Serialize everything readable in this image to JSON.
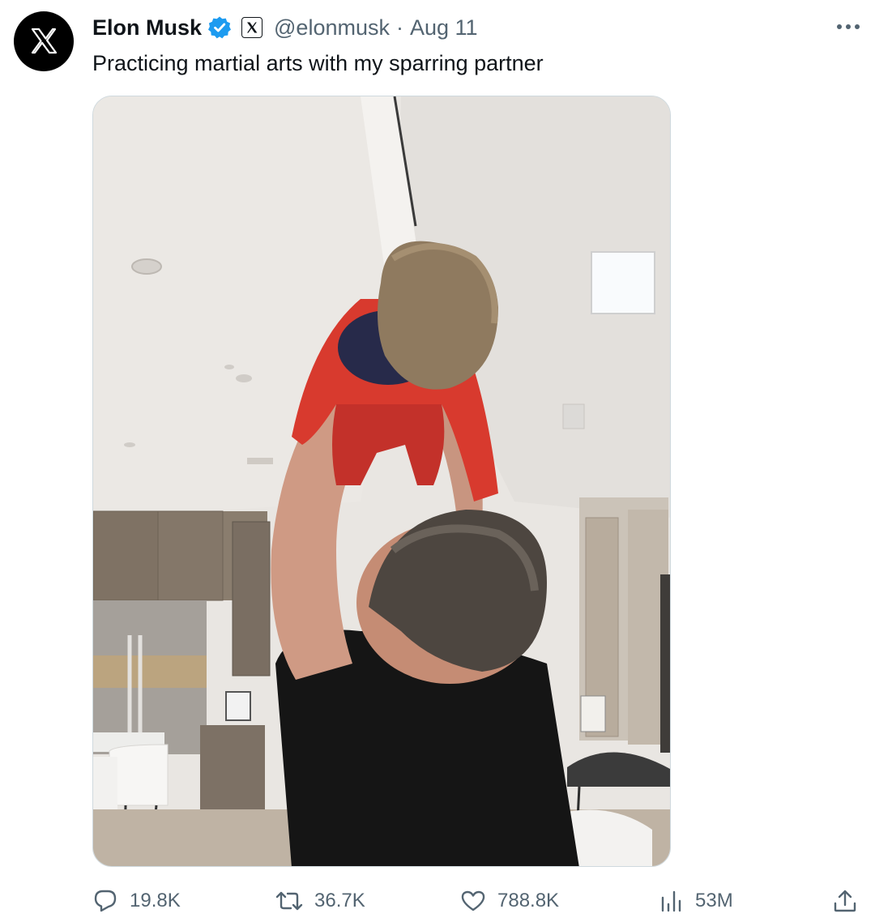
{
  "author": {
    "name": "Elon Musk",
    "handle": "@elonmusk",
    "separator": "·",
    "date": "Aug 11"
  },
  "tweet": {
    "text": "Practicing martial arts with my sparring partner"
  },
  "media": {
    "alt": ""
  },
  "actions": {
    "replies": "19.8K",
    "reposts": "36.7K",
    "likes": "788.8K",
    "views": "53M"
  },
  "colors": {
    "text": "#0f1419",
    "secondary": "#536471",
    "verified": "#1d9bf0",
    "border": "#cfd9de"
  },
  "icons": {
    "avatar": "x-logo-icon",
    "verified": "verified-badge-icon",
    "affiliate": "x-affiliate-icon",
    "more": "more-dots-icon",
    "reply": "reply-icon",
    "repost": "repost-icon",
    "like": "heart-icon",
    "views": "views-chart-icon",
    "share": "share-icon"
  }
}
